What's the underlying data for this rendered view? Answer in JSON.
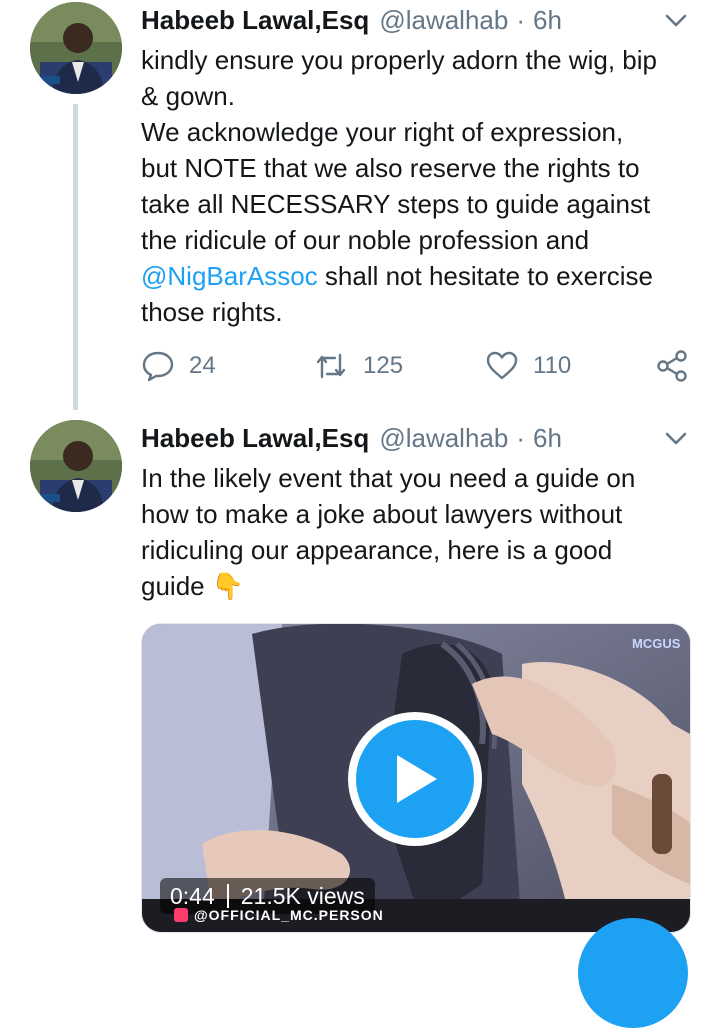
{
  "tweets": [
    {
      "author_name": "Habeeb Lawal,Esq",
      "handle": "@lawalhab",
      "separator": "·",
      "time": "6h",
      "text_before_mention": "kindly ensure you properly adorn the wig, bip\n& gown.\nWe acknowledge your right of expression,\nbut NOTE that we also reserve the rights to\ntake all NECESSARY steps to guide against\nthe ridicule of our noble profession and\n",
      "mention": "@NigBarAssoc",
      "text_after_mention": " shall not hesitate to exercise\nthose rights.",
      "actions": {
        "replies": "24",
        "retweets": "125",
        "likes": "110"
      }
    },
    {
      "author_name": "Habeeb Lawal,Esq",
      "handle": "@lawalhab",
      "separator": "·",
      "time": "6h",
      "text": "In the likely event that you need a guide on\nhow to make a joke about lawyers without\nridiculing our appearance, here is a good\nguide ",
      "emoji": "👇",
      "video": {
        "duration": "0:44",
        "views": "21.5K views",
        "watermark": "@OFFICIAL_MC.PERSON",
        "brand_mark": "MCGUS"
      }
    }
  ],
  "icons": {
    "reply": "reply-icon",
    "retweet": "retweet-icon",
    "like": "heart-icon",
    "share": "share-icon",
    "caret": "chevron-down-icon",
    "play": "play-icon",
    "compose": "compose-fab"
  },
  "colors": {
    "accent": "#1da1f2",
    "secondary_text": "#657786",
    "thread_line": "#cfd9de"
  }
}
